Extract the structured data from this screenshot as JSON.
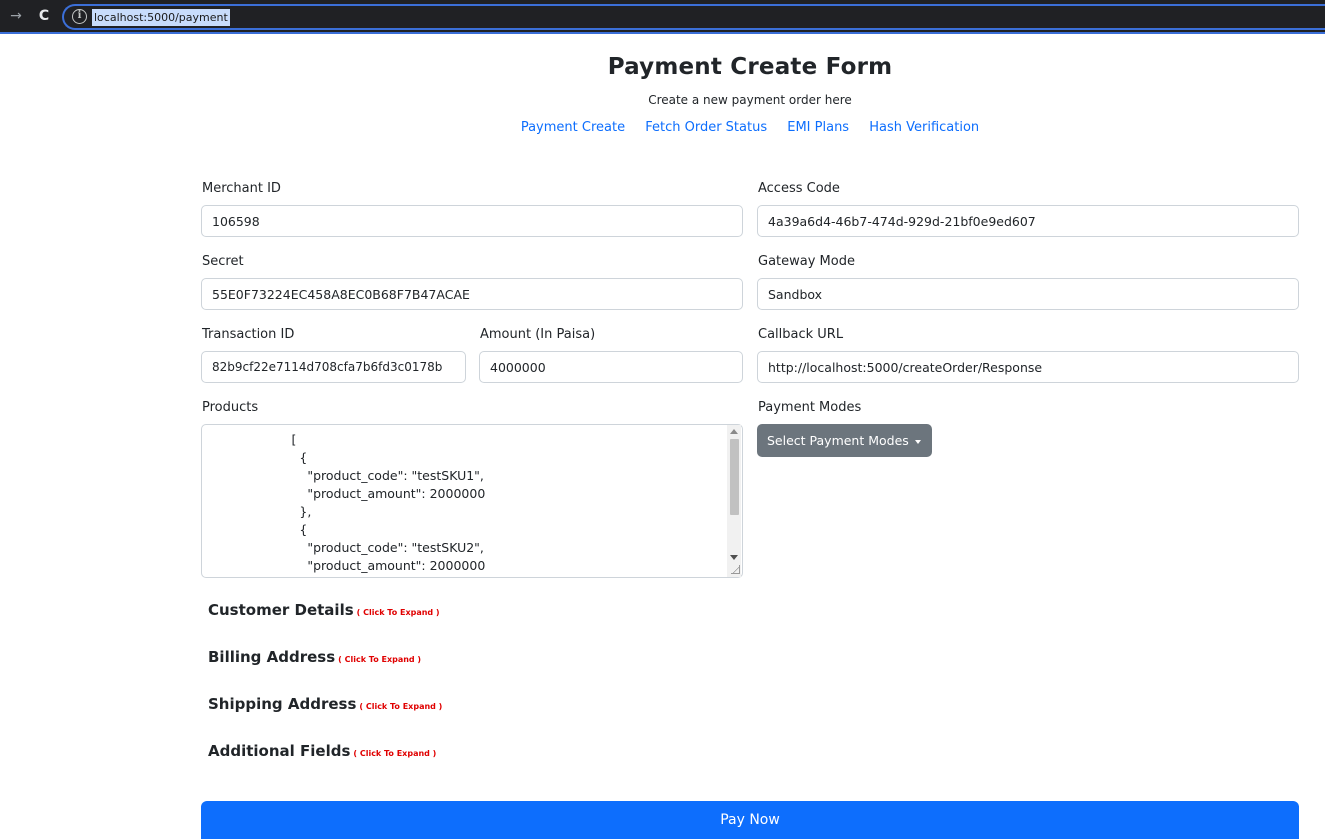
{
  "browser": {
    "url": "localhost:5000/payment"
  },
  "header": {
    "title": "Payment Create Form",
    "subtitle": "Create a new payment order here",
    "links": [
      "Payment Create",
      "Fetch Order Status",
      "EMI Plans",
      "Hash Verification"
    ]
  },
  "form": {
    "merchant_id": {
      "label": "Merchant ID",
      "value": "106598"
    },
    "access_code": {
      "label": "Access Code",
      "value": "4a39a6d4-46b7-474d-929d-21bf0e9ed607"
    },
    "secret": {
      "label": "Secret",
      "value": "55E0F73224EC458A8EC0B68F7B47ACAE"
    },
    "gateway_mode": {
      "label": "Gateway Mode",
      "value": "Sandbox"
    },
    "transaction_id": {
      "label": "Transaction ID",
      "value": "82b9cf22e7114d708cfa7b6fd3c0178b"
    },
    "amount": {
      "label": "Amount (In Paisa)",
      "value": "4000000"
    },
    "callback_url": {
      "label": "Callback URL",
      "value": "http://localhost:5000/createOrder/Response"
    },
    "products": {
      "label": "Products",
      "value": "                    [\n                      {\n                        \"product_code\": \"testSKU1\",\n                        \"product_amount\": 2000000\n                      },\n                      {\n                        \"product_code\": \"testSKU2\",\n                        \"product_amount\": 2000000\n                      }\n                    ]"
    },
    "payment_modes": {
      "label": "Payment Modes",
      "button_label": "Select Payment Modes"
    }
  },
  "sections": [
    {
      "title": "Customer Details",
      "hint": "( Click To Expand )"
    },
    {
      "title": "Billing Address",
      "hint": "( Click To Expand )"
    },
    {
      "title": "Shipping Address",
      "hint": "( Click To Expand )"
    },
    {
      "title": "Additional Fields",
      "hint": "( Click To Expand )"
    }
  ],
  "submit_label": "Pay Now",
  "colors": {
    "primary": "#0d6efd",
    "secondary": "#6c757d",
    "expand_hint": "#e00000"
  }
}
